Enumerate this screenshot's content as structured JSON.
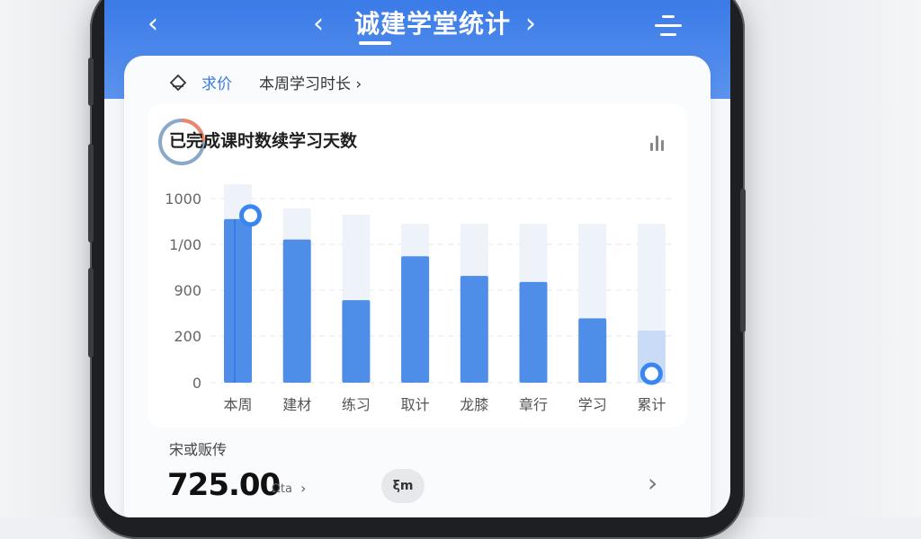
{
  "header": {
    "back_glyph": "‹",
    "prev_glyph": "‹",
    "next_glyph": "›",
    "title": "诚建学堂统计",
    "menu_icon": "menu-icon"
  },
  "tabs": {
    "active_label": "求价",
    "other_label": "本周学习时长 ›"
  },
  "chart_header": {
    "title": "已完成课时数续学习天数",
    "type_icon": "bar-chart-icon"
  },
  "chart_data": {
    "type": "bar",
    "categories": [
      "本周",
      "建材",
      "练习",
      "取计",
      "龙膝",
      "章行",
      "学习",
      "累计"
    ],
    "series": [
      {
        "values": [
          1080,
          945,
          545,
          835,
          705,
          665,
          425,
          0
        ]
      },
      {
        "values": [
          1310,
          1150,
          1110,
          1050,
          1050,
          1050,
          1050,
          1050
        ]
      }
    ],
    "yticks": [
      "1000",
      "1/00",
      "900",
      "200",
      "0"
    ],
    "ylim": [
      0,
      1370
    ],
    "grid": true,
    "highlight_markers": [
      0,
      7
    ],
    "colors": {
      "bar": "#4f8ee8",
      "bar_light": "#7fb0f2",
      "track": "#eef2f9",
      "marker": "#3a86f0"
    }
  },
  "summary": {
    "label": "宋或贩传",
    "value": "725.00",
    "unit": "Ωta",
    "chevron": "›",
    "pill_text": "ξm",
    "arrow": "›"
  }
}
